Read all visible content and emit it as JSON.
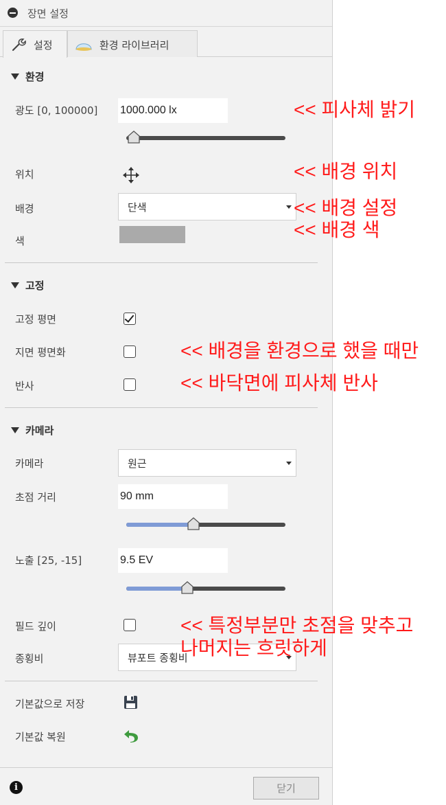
{
  "window": {
    "title": "장면 설정"
  },
  "tabs": [
    {
      "label": "설정",
      "active": true,
      "icon": "wrench-icon"
    },
    {
      "label": "환경 라이브러리",
      "active": false,
      "icon": "dome-light-icon"
    }
  ],
  "environment": {
    "heading": "환경",
    "brightness_label": "광도 [0, 100000]",
    "brightness_value": "1000.000 lx",
    "brightness_slider_fraction": 0.02,
    "position_label": "위치",
    "background_label": "배경",
    "background_value": "단색",
    "color_label": "색",
    "color_value": "#aaaaaa"
  },
  "ground": {
    "heading": "고정",
    "ground_plane_label": "고정 평면",
    "ground_plane_checked": true,
    "flatten_ground_label": "지면 평면화",
    "flatten_ground_checked": false,
    "reflection_label": "반사",
    "reflection_checked": false
  },
  "camera": {
    "heading": "카메라",
    "camera_label": "카메라",
    "camera_value": "원근",
    "focal_label": "초점 거리",
    "focal_value": "90 mm",
    "focal_slider_fraction": 0.42,
    "exposure_label": "노출 [25, -15]",
    "exposure_value": "9.5 EV",
    "exposure_slider_fraction": 0.38,
    "dof_label": "필드 깊이",
    "dof_checked": false,
    "aspect_label": "종횡비",
    "aspect_value": "뷰포트 종횡비"
  },
  "footer": {
    "save_default_label": "기본값으로 저장",
    "restore_default_label": "기본값 복원",
    "close_label": "닫기"
  },
  "annotations": {
    "brightness": "<< 피사체 밝기",
    "position": "<< 배경 위치",
    "background": "<< 배경 설정",
    "color": "<< 배경 색",
    "flatten": "<< 배경을 환경으로 했을 때만",
    "reflection": "<< 바닥면에 피사체 반사",
    "dof_line1": "<< 특정부분만 초점을 맞추고",
    "dof_line2": "나머지는 흐릿하게"
  },
  "colors": {
    "annotation": "#ff1a1a",
    "slider_fill": "#7f9bd6",
    "save_icon": "#3a4350",
    "undo_icon": "#3f9b3f"
  }
}
